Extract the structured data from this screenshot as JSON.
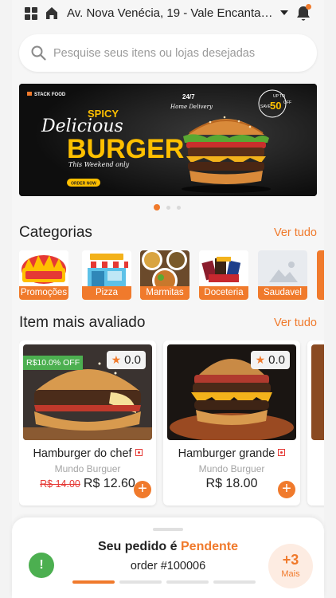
{
  "header": {
    "address": "Av. Nova Venécia, 19 - Vale Encantad...",
    "icons": [
      "grid-icon",
      "home-icon",
      "chevron-down-icon",
      "bell-icon"
    ]
  },
  "search": {
    "placeholder": "Pesquise seus itens ou lojas desejadas"
  },
  "banner": {
    "brand": "STACK FOOD",
    "line1": "SPICY",
    "line2": "Delicious",
    "line3": "BURGER",
    "line4": "This Weekend only",
    "button": "ORDER NOW",
    "tag1": "24/7",
    "tag2": "Home Delivery",
    "promo_top": "UP TO",
    "promo_value": "50",
    "promo_off": "OFF",
    "promo_save": "SAVE",
    "pages": 3,
    "active_page": 0
  },
  "categories": {
    "title": "Categorias",
    "see_all": "Ver tudo",
    "items": [
      {
        "label": "Promoções"
      },
      {
        "label": "Pizza"
      },
      {
        "label": "Marmitas"
      },
      {
        "label": "Doceteria"
      },
      {
        "label": "Saudavel"
      }
    ]
  },
  "top_rated": {
    "title": "Item mais avaliado",
    "see_all": "Ver tudo",
    "items": [
      {
        "name": "Hamburger do chef",
        "store": "Mundo Burguer",
        "old_price": "R$ 14.00",
        "price": "R$ 12.60",
        "rating": "0.0",
        "discount": "R$10.0% OFF"
      },
      {
        "name": "Hamburger grande",
        "store": "Mundo Burguer",
        "price": "R$ 18.00",
        "rating": "0.0"
      }
    ]
  },
  "order": {
    "status_prefix": "Seu pedido é",
    "status": "Pendente",
    "number": "order #100006",
    "more_count": "+3",
    "more_label": "Mais",
    "steps_total": 4,
    "steps_done": 1
  },
  "colors": {
    "accent": "#f07a2c",
    "success": "#4caf50",
    "danger": "#e53935"
  }
}
